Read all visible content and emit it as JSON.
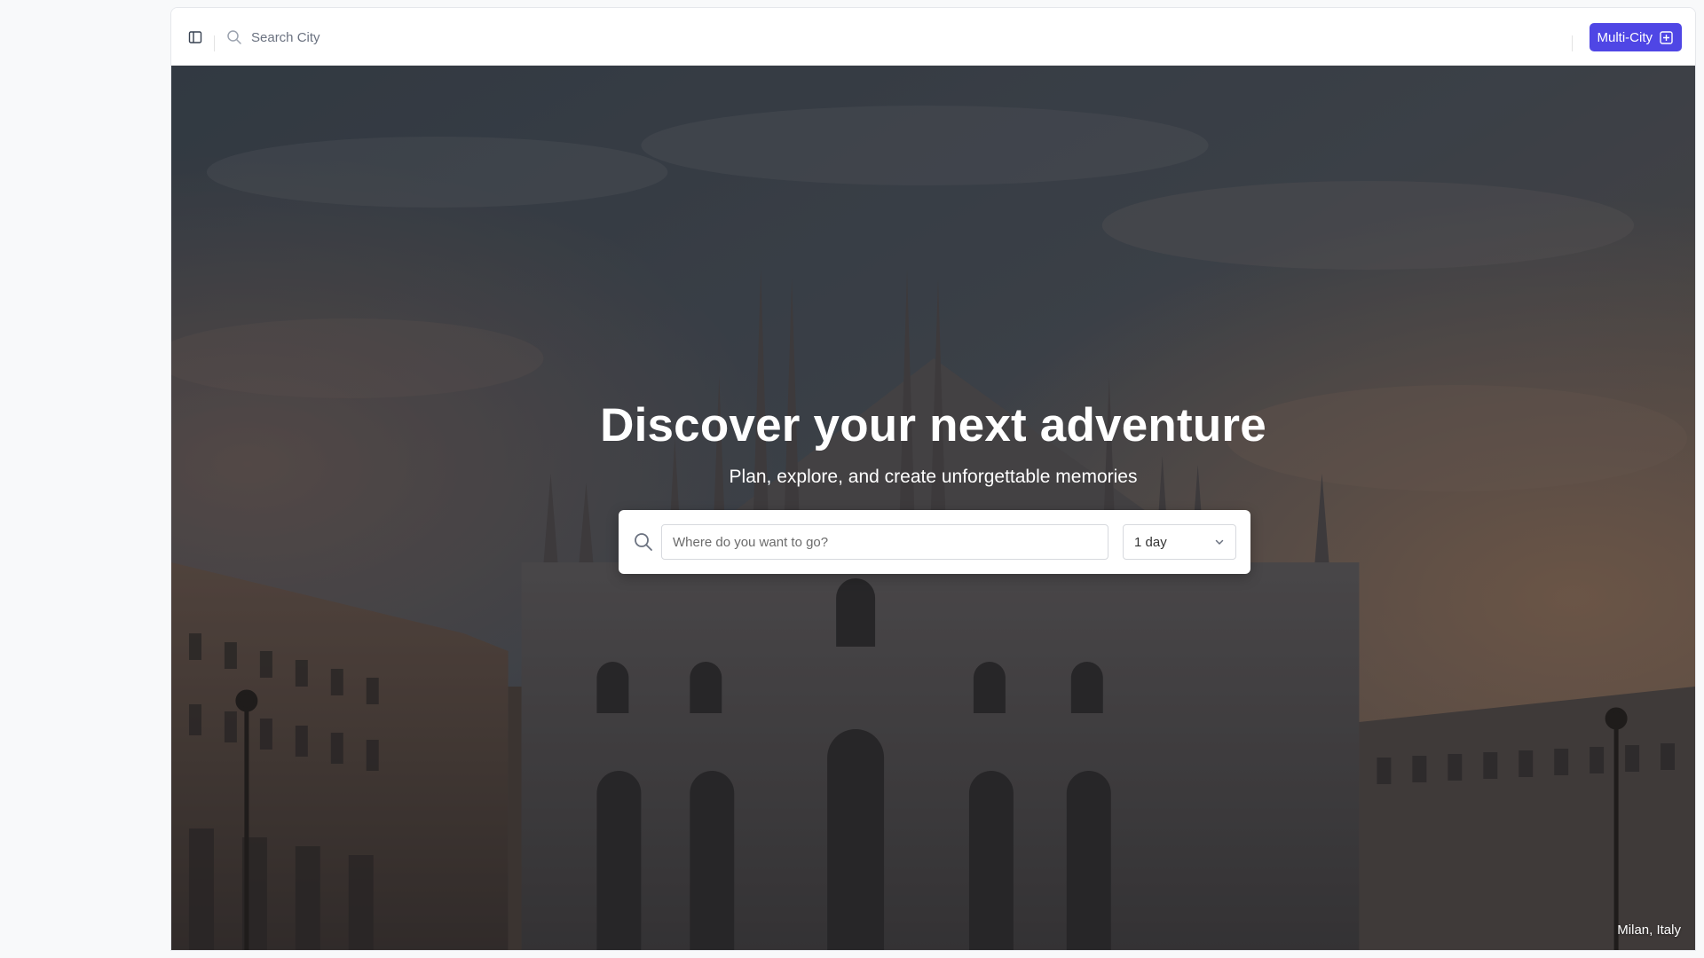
{
  "topbar": {
    "search_label": "Search City",
    "multi_city_label": "Multi-City"
  },
  "hero": {
    "title": "Discover your next adventure",
    "subtitle": "Plan, explore, and create unforgettable memories",
    "search": {
      "placeholder": "Where do you want to go?",
      "value": "",
      "duration_selected": "1 day"
    },
    "location_caption": "Milan, Italy"
  },
  "colors": {
    "accent": "#4f46e5",
    "hero_overlay": "#2a2e36"
  },
  "icons": {
    "sidebar_toggle": "sidebar-toggle-icon",
    "topbar_search": "search-icon",
    "multi_city": "plus-square-icon",
    "card_search": "search-icon",
    "select_caret": "chevron-down-icon"
  }
}
